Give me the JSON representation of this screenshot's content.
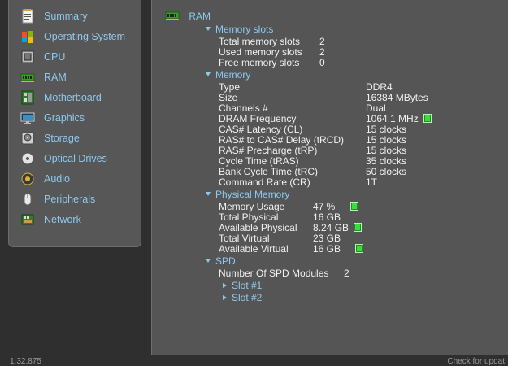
{
  "sidebar": {
    "items": [
      {
        "label": "Summary",
        "icon": "summary-icon"
      },
      {
        "label": "Operating System",
        "icon": "windows-logo-icon"
      },
      {
        "label": "CPU",
        "icon": "cpu-icon"
      },
      {
        "label": "RAM",
        "icon": "ram-icon"
      },
      {
        "label": "Motherboard",
        "icon": "motherboard-icon"
      },
      {
        "label": "Graphics",
        "icon": "monitor-icon"
      },
      {
        "label": "Storage",
        "icon": "hard-drive-icon"
      },
      {
        "label": "Optical Drives",
        "icon": "optical-disc-icon"
      },
      {
        "label": "Audio",
        "icon": "speaker-icon"
      },
      {
        "label": "Peripherals",
        "icon": "mouse-icon"
      },
      {
        "label": "Network",
        "icon": "network-icon"
      }
    ]
  },
  "main": {
    "title": "RAM",
    "memory_slots": {
      "heading": "Memory slots",
      "rows": [
        {
          "key": "Total memory slots",
          "value": "2"
        },
        {
          "key": "Used memory slots",
          "value": "2"
        },
        {
          "key": "Free memory slots",
          "value": "0"
        }
      ]
    },
    "memory": {
      "heading": "Memory",
      "rows": [
        {
          "key": "Type",
          "value": "DDR4"
        },
        {
          "key": "Size",
          "value": "16384 MBytes"
        },
        {
          "key": "Channels #",
          "value": "Dual"
        },
        {
          "key": "DRAM Frequency",
          "value": "1064.1 MHz"
        },
        {
          "key": "CAS# Latency (CL)",
          "value": "15 clocks"
        },
        {
          "key": "RAS# to CAS# Delay (tRCD)",
          "value": "15 clocks"
        },
        {
          "key": "RAS# Precharge (tRP)",
          "value": "15 clocks"
        },
        {
          "key": "Cycle Time (tRAS)",
          "value": "35 clocks"
        },
        {
          "key": "Bank Cycle Time (tRC)",
          "value": "50 clocks"
        },
        {
          "key": "Command Rate (CR)",
          "value": "1T"
        }
      ]
    },
    "physical_memory": {
      "heading": "Physical Memory",
      "rows": [
        {
          "key": "Memory Usage",
          "value": "47 %"
        },
        {
          "key": "Total Physical",
          "value": "16 GB"
        },
        {
          "key": "Available Physical",
          "value": "8.24 GB"
        },
        {
          "key": "Total Virtual",
          "value": "23 GB"
        },
        {
          "key": "Available Virtual",
          "value": "16 GB"
        }
      ]
    },
    "spd": {
      "heading": "SPD",
      "modules_key": "Number Of SPD Modules",
      "modules_value": "2",
      "slots": [
        "Slot #1",
        "Slot #2"
      ]
    }
  },
  "status": {
    "left": "1.32.875",
    "right": "Check for updat"
  },
  "colors": {
    "accent": "#8ec8ef",
    "indicator": "#3ddc3d"
  }
}
